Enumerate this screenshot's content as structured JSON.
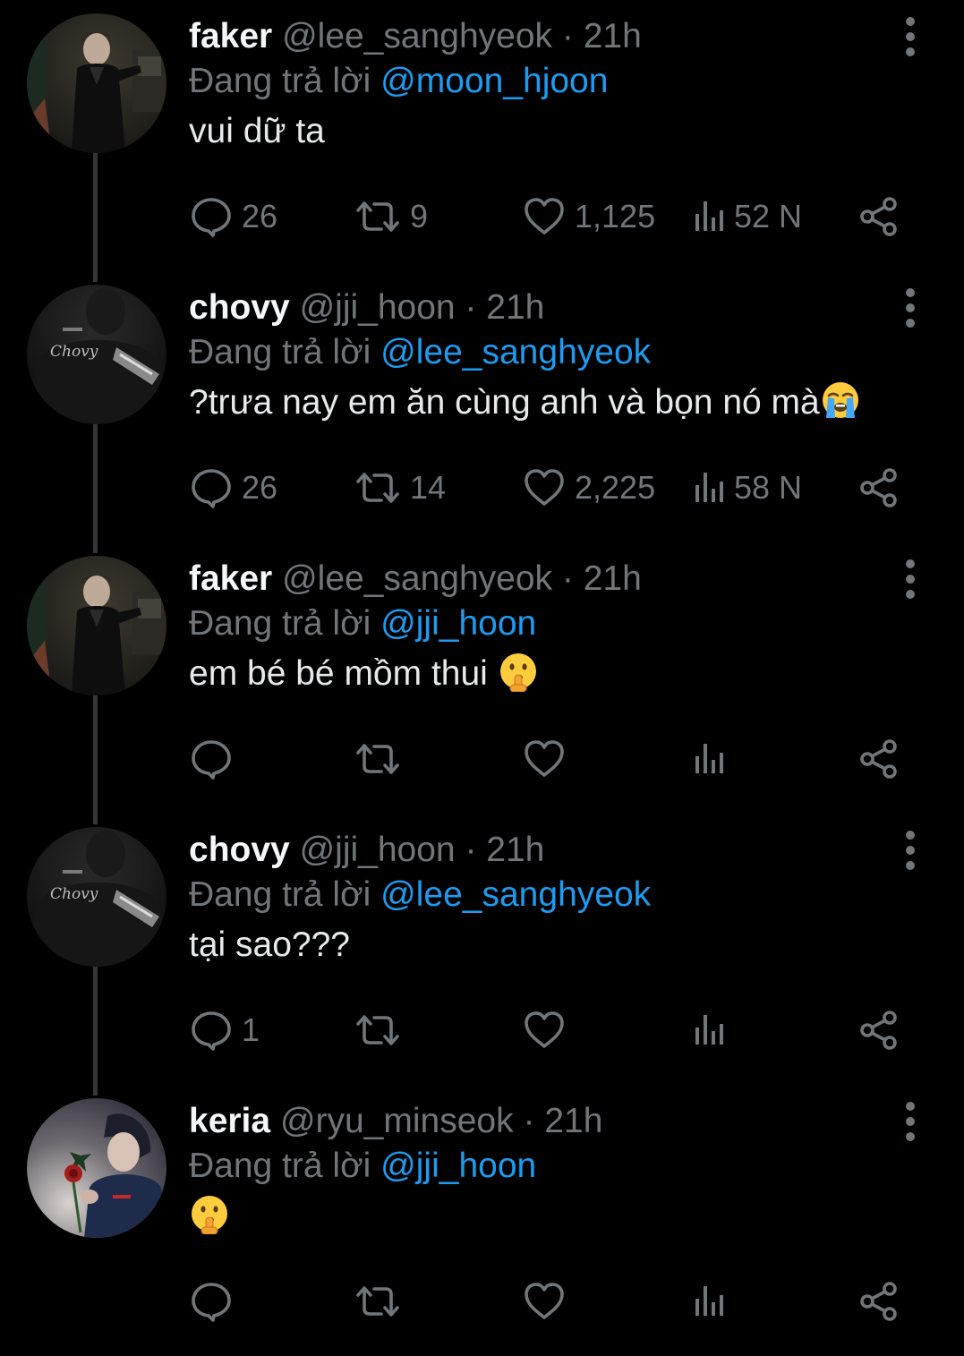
{
  "reply_prefix": "Đang trả lời",
  "tweets": [
    {
      "name": "faker",
      "handle": "@lee_sanghyeok",
      "separator": "·",
      "time": "21h",
      "replying_to": "@moon_hjoon",
      "text": "vui dữ ta",
      "emoji": "",
      "avatar": "faker-avatar",
      "counts": {
        "replies": "26",
        "retweets": "9",
        "likes": "1,125",
        "views": "52 N"
      }
    },
    {
      "name": "chovy",
      "handle": "@jji_hoon",
      "separator": "·",
      "time": "21h",
      "replying_to": "@lee_sanghyeok",
      "text": "?trưa nay em ăn cùng anh và bọn nó mà",
      "emoji": "loudly-crying-face-emoji",
      "avatar": "chovy-avatar",
      "counts": {
        "replies": "26",
        "retweets": "14",
        "likes": "2,225",
        "views": "58 N"
      }
    },
    {
      "name": "faker",
      "handle": "@lee_sanghyeok",
      "separator": "·",
      "time": "21h",
      "replying_to": "@jji_hoon",
      "text": "em bé bé mồm thui ",
      "emoji": "shushing-face-emoji",
      "avatar": "faker-avatar",
      "counts": {
        "replies": "",
        "retweets": "",
        "likes": "",
        "views": ""
      }
    },
    {
      "name": "chovy",
      "handle": "@jji_hoon",
      "separator": "·",
      "time": "21h",
      "replying_to": "@lee_sanghyeok",
      "text": "tại sao???",
      "emoji": "",
      "avatar": "chovy-avatar",
      "counts": {
        "replies": "1",
        "retweets": "",
        "likes": "",
        "views": ""
      }
    },
    {
      "name": "keria",
      "handle": "@ryu_minseok",
      "separator": "·",
      "time": "21h",
      "replying_to": "@jji_hoon",
      "text": "",
      "emoji": "shushing-face-emoji",
      "avatar": "keria-avatar",
      "counts": {
        "replies": "",
        "retweets": "",
        "likes": "",
        "views": ""
      }
    }
  ],
  "colors": {
    "background": "#000000",
    "text": "#e7e9ea",
    "muted": "#71767b",
    "link": "#1d9bf0",
    "thread_line": "#333639"
  }
}
